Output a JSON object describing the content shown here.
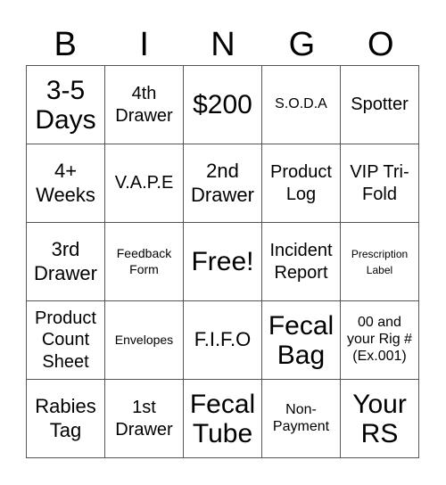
{
  "header": [
    "B",
    "I",
    "N",
    "G",
    "O"
  ],
  "cells": [
    [
      {
        "text": "3-5\nDays",
        "size": "xl"
      },
      {
        "text": "4th\nDrawer",
        "size": "m"
      },
      {
        "text": "$200",
        "size": "xl"
      },
      {
        "text": "S.O.D.A",
        "size": "s"
      },
      {
        "text": "Spotter",
        "size": "m"
      }
    ],
    [
      {
        "text": "4+\nWeeks",
        "size": "l"
      },
      {
        "text": "V.A.P.E",
        "size": "m"
      },
      {
        "text": "2nd\nDrawer",
        "size": "l"
      },
      {
        "text": "Product\nLog",
        "size": "m"
      },
      {
        "text": "VIP Tri-\nFold",
        "size": "m"
      }
    ],
    [
      {
        "text": "3rd\nDrawer",
        "size": "l"
      },
      {
        "text": "Feedback\nForm",
        "size": "s-small"
      },
      {
        "text": "Free!",
        "size": "xl-free"
      },
      {
        "text": "Incident\nReport",
        "size": "m"
      },
      {
        "text": "Prescription\nLabel",
        "size": "xs"
      }
    ],
    [
      {
        "text": "Product\nCount\nSheet",
        "size": "m"
      },
      {
        "text": "Envelopes",
        "size": "s-small"
      },
      {
        "text": "F.I.F.O",
        "size": "l"
      },
      {
        "text": "Fecal\nBag",
        "size": "xl"
      },
      {
        "text": "00 and\nyour Rig #\n(Ex.001)",
        "size": "s"
      }
    ],
    [
      {
        "text": "Rabies\nTag",
        "size": "l"
      },
      {
        "text": "1st\nDrawer",
        "size": "m"
      },
      {
        "text": "Fecal\nTube",
        "size": "xl"
      },
      {
        "text": "Non-\nPayment",
        "size": "s"
      },
      {
        "text": "Your\nRS",
        "size": "xl"
      }
    ]
  ]
}
